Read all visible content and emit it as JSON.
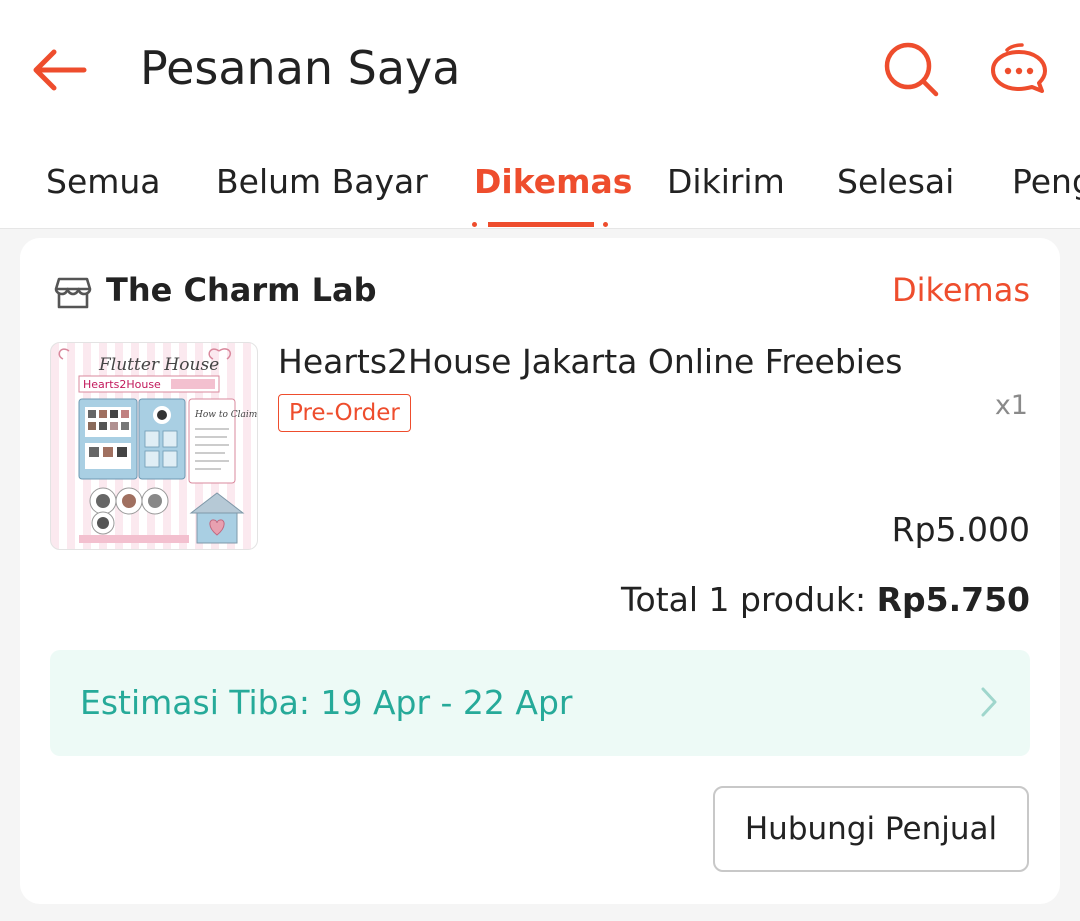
{
  "header": {
    "title": "Pesanan Saya",
    "back_icon": "arrow-left-icon",
    "search_icon": "search-icon",
    "chat_icon": "chat-icon",
    "accent_color": "#ee4d2d"
  },
  "tabs": [
    {
      "label": "Semua",
      "active": false
    },
    {
      "label": "Belum Bayar",
      "active": false
    },
    {
      "label": "Dikemas",
      "active": true
    },
    {
      "label": "Dikirim",
      "active": false
    },
    {
      "label": "Selesai",
      "active": false
    },
    {
      "label": "Pengembalian",
      "active": false
    }
  ],
  "order": {
    "shop_icon": "store-icon",
    "shop_name": "The Charm Lab",
    "status": "Dikemas",
    "product": {
      "name": "Hearts2House Jakarta Online Freebies",
      "badge": "Pre-Order",
      "quantity": "x1",
      "price": "Rp5.000",
      "thumbnail": {
        "title": "Flutter House",
        "subtitle": "Hearts2House",
        "side_text": "How to Claim?"
      }
    },
    "total": {
      "label": "Total 1 produk:",
      "amount": "Rp5.750"
    },
    "estimate": {
      "text": "Estimasi Tiba: 19 Apr - 22 Apr",
      "color": "#26aa99",
      "chevron_icon": "chevron-right-icon"
    },
    "contact_button": "Hubungi Penjual"
  }
}
